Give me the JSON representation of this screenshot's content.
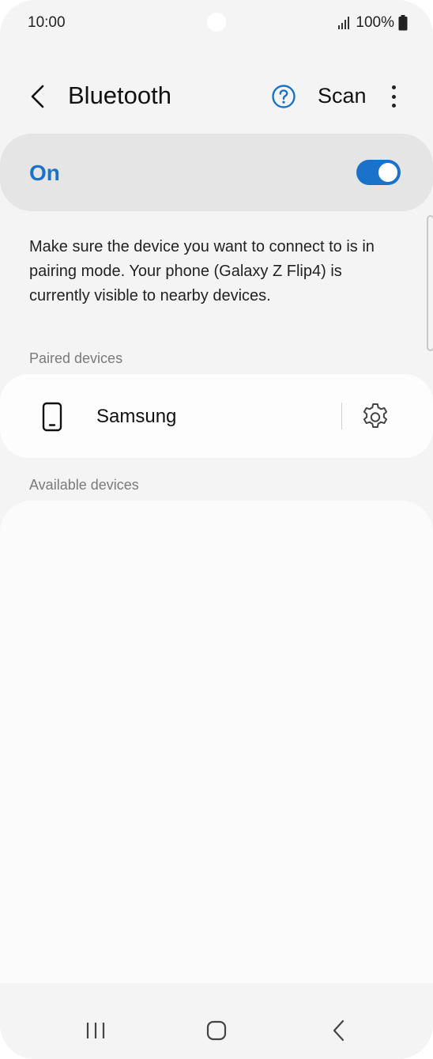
{
  "status_bar": {
    "time": "10:00",
    "battery_text": "100%",
    "icons": [
      "signal-icon",
      "battery-icon"
    ]
  },
  "app_bar": {
    "title": "Bluetooth",
    "scan_label": "Scan",
    "icons": [
      "back-arrow-icon",
      "help-icon",
      "more-options-icon"
    ]
  },
  "master_switch": {
    "label": "On",
    "state": "on",
    "accent_color": "#1a73c9"
  },
  "description": "Make sure the device you want to connect to is in pairing mode. Your phone (Galaxy Z Flip4) is currently visible to nearby devices.",
  "paired_devices": {
    "header": "Paired devices",
    "items": [
      {
        "name": "Samsung",
        "icon": "phone-icon",
        "settings_icon": "gear-icon"
      }
    ]
  },
  "available_devices": {
    "header": "Available devices",
    "items": []
  },
  "navigation_bar": {
    "icons": [
      "recents-icon",
      "home-icon",
      "back-icon"
    ]
  }
}
